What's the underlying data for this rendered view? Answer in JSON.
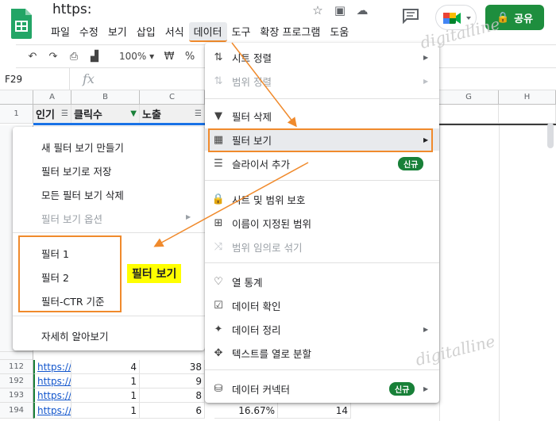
{
  "window": {
    "title": "https:"
  },
  "menubar": [
    {
      "label": "파일"
    },
    {
      "label": "수정"
    },
    {
      "label": "보기"
    },
    {
      "label": "삽입"
    },
    {
      "label": "서식"
    },
    {
      "label": "데이터"
    },
    {
      "label": "도구"
    },
    {
      "label": "확장 프로그램"
    },
    {
      "label": "도움"
    }
  ],
  "share": {
    "label": "공유"
  },
  "toolbar": {
    "zoom": "100%",
    "currency": "₩",
    "percent": "%"
  },
  "formula": {
    "cell_ref": "F29",
    "fx": "fx"
  },
  "columns": [
    "A",
    "B",
    "C",
    "G",
    "H"
  ],
  "header_row": {
    "num": "1",
    "a": "인기",
    "b": "클릭수",
    "c": "노출"
  },
  "bottom_rows": [
    {
      "num": "112",
      "a": "https://di",
      "b": "4",
      "c": "38",
      "d": "",
      "e": ""
    },
    {
      "num": "192",
      "a": "https://di",
      "b": "1",
      "c": "9",
      "d": "",
      "e": ""
    },
    {
      "num": "193",
      "a": "https://di",
      "b": "1",
      "c": "8",
      "d": "",
      "e": ""
    },
    {
      "num": "194",
      "a": "https://di",
      "b": "1",
      "c": "6",
      "d": "16.67%",
      "e": "14"
    }
  ],
  "filter_views_menu": {
    "items": [
      "새 필터 보기 만들기",
      "필터 보기로 저장",
      "모든 필터 보기 삭제"
    ],
    "options_label": "필터 보기 옵션",
    "saved": [
      "필터 1",
      "필터 2",
      "필터-CTR 기준"
    ],
    "learn_more": "자세히 알아보기"
  },
  "callout": "필터 보기",
  "data_menu": {
    "sort_sheet": "시트 정렬",
    "sort_range": "범위 정렬",
    "remove_filter": "필터 삭제",
    "filter_views": "필터 보기",
    "add_slicer": "슬라이서 추가",
    "new_badge": "신규",
    "protect": "시트 및 범위 보호",
    "named_ranges": "이름이 지정된 범위",
    "randomize": "범위 임의로 섞기",
    "column_stats": "열 통계",
    "validation": "데이터 확인",
    "cleanup": "데이터 정리",
    "split_text": "텍스트를 열로 분할",
    "connectors": "데이터 커넥터"
  },
  "watermark": "digitalline",
  "colors": {
    "accent_orange": "#f08a2c",
    "share_green": "#1e8e3e",
    "badge_green": "#188038",
    "link_blue": "#1155cc"
  }
}
